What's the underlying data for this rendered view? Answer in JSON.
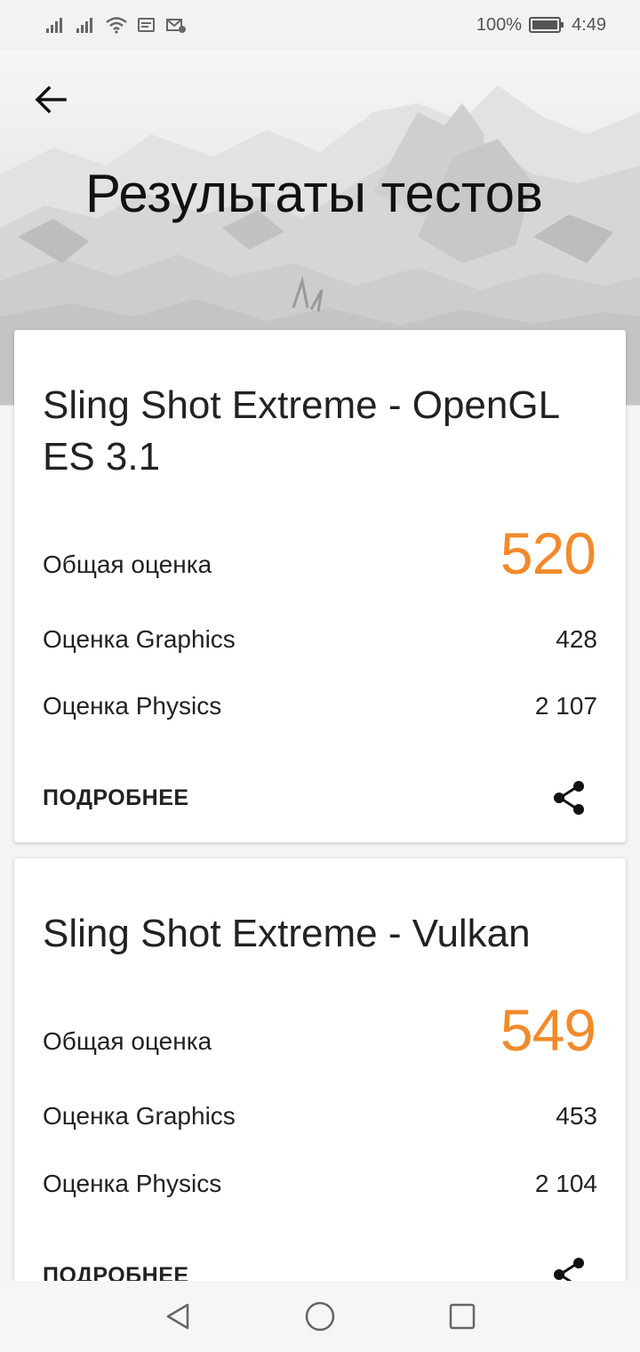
{
  "status_bar": {
    "battery_text": "100%",
    "time": "4:49",
    "icons": [
      "signal-icon",
      "signal-icon",
      "wifi-icon",
      "notification-icon",
      "mail-icon",
      "battery-icon"
    ]
  },
  "header": {
    "back_icon": "arrow-left-icon",
    "title": "Результаты тестов"
  },
  "results": [
    {
      "title": "Sling Shot Extreme - OpenGL ES 3.1",
      "overall_label": "Общая оценка",
      "overall_value": "520",
      "graphics_label": "Оценка Graphics",
      "graphics_value": "428",
      "physics_label": "Оценка Physics",
      "physics_value": "2 107",
      "more_label": "ПОДРОБНЕЕ",
      "share_icon": "share-icon"
    },
    {
      "title": "Sling Shot Extreme - Vulkan",
      "overall_label": "Общая оценка",
      "overall_value": "549",
      "graphics_label": "Оценка Graphics",
      "graphics_value": "453",
      "physics_label": "Оценка Physics",
      "physics_value": "2 104",
      "more_label": "ПОДРОБНЕЕ",
      "share_icon": "share-icon"
    }
  ],
  "colors": {
    "score_accent": "#f28a2b",
    "card_background": "#ffffff",
    "page_background": "#f4f4f4"
  },
  "nav_bar": {
    "icons": [
      "back-triangle-icon",
      "home-circle-icon",
      "recents-square-icon"
    ]
  }
}
